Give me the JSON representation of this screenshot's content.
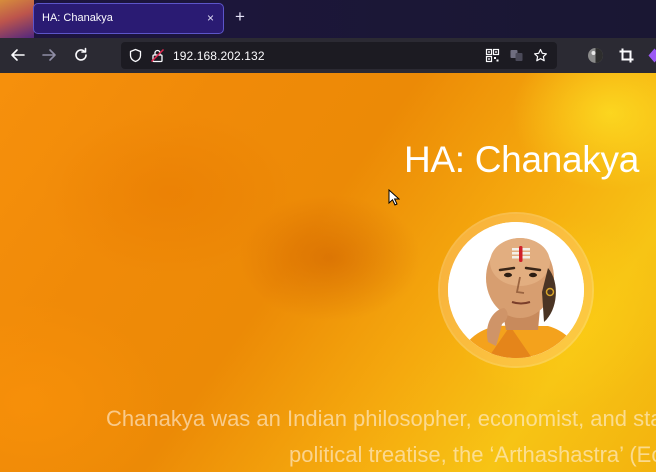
{
  "tab": {
    "title": "HA: Chanakya",
    "close_glyph": "×"
  },
  "new_tab_glyph": "+",
  "nav": {
    "back": "arrow-left-icon",
    "forward": "arrow-right-icon",
    "reload": "reload-icon"
  },
  "address": {
    "url": "192.168.202.132"
  },
  "toolbar_icons": [
    "qr-code-icon",
    "translate-icon",
    "bookmark-star-icon",
    "account-avatar-icon",
    "crop-icon",
    "extension-icon"
  ],
  "page": {
    "title": "HA: Chanakya",
    "description": [
      "Chanakya was an Indian philosopher, economist, and stat",
      "political treatise, the ‘Arthashastra’ (Eco"
    ]
  },
  "colors": {
    "tab_bg": "#2a1b73",
    "tab_border": "#5c55c9",
    "navbar": "#2b2a33",
    "page_orange": "#f08a08",
    "page_yellow": "#f7c415"
  }
}
